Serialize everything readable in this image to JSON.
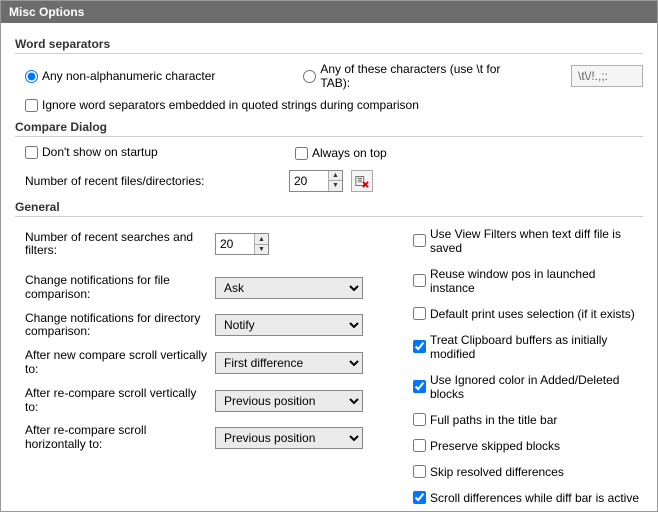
{
  "window": {
    "title": "Misc Options"
  },
  "wordSeparators": {
    "header": "Word separators",
    "anyNonAlnum": "Any non-alphanumeric character",
    "anyOfThese": "Any of these characters (use \\t for TAB):",
    "charsValue": "\\t\\/!.,;:",
    "ignoreQuoted": "Ignore word separators embedded in quoted strings during comparison"
  },
  "compareDialog": {
    "header": "Compare Dialog",
    "dontShowStartup": "Don't show on startup",
    "alwaysOnTop": "Always on top",
    "recentFilesLabel": "Number of recent files/directories:",
    "recentFilesValue": "20"
  },
  "general": {
    "header": "General",
    "recentSearchesLabel": "Number of recent searches and filters:",
    "recentSearchesValue": "20",
    "changeNotifFile": {
      "label": "Change notifications for file comparison:",
      "value": "Ask"
    },
    "changeNotifDir": {
      "label": "Change notifications for directory comparison:",
      "value": "Notify"
    },
    "afterNewCompareV": {
      "label": "After new compare scroll vertically to:",
      "value": "First difference"
    },
    "afterReCompareV": {
      "label": "After re-compare scroll vertically to:",
      "value": "Previous position"
    },
    "afterReCompareH": {
      "label": "After re-compare scroll horizontally to:",
      "value": "Previous position"
    },
    "checks": {
      "useViewFilters": "Use View Filters when text diff file is saved",
      "reuseWindowPos": "Reuse window pos in launched instance",
      "defaultPrintSel": "Default print uses selection (if it exists)",
      "treatClipboard": "Treat Clipboard buffers as initially modified",
      "useIgnoredColor": "Use Ignored color in Added/Deleted blocks",
      "fullPathsTitle": "Full paths in the title bar",
      "preserveSkipped": "Preserve skipped blocks",
      "skipResolved": "Skip resolved differences",
      "scrollDiffActive": "Scroll differences while diff bar is active"
    }
  }
}
